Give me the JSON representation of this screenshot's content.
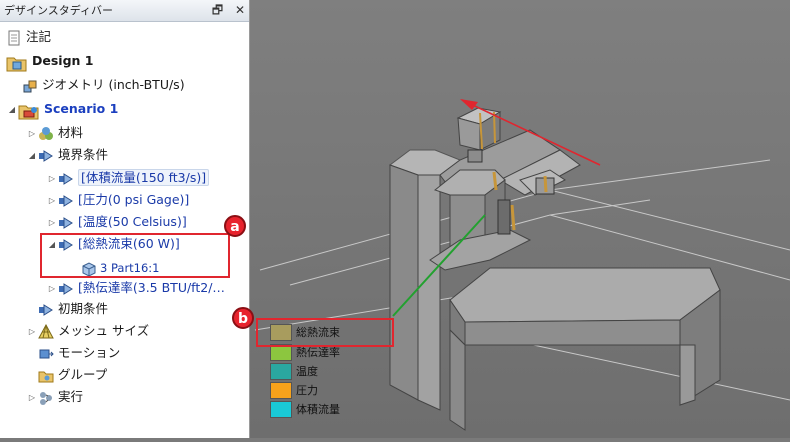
{
  "panel": {
    "title": "デザインスタディバー",
    "restore_glyph": "🗗",
    "close_glyph": "✕"
  },
  "tree": {
    "notes": "注記",
    "design": "Design 1",
    "geometry": "ジオメトリ (inch-BTU/s)",
    "scenario": "Scenario 1",
    "materials": "材料",
    "boundary_conditions": "境界条件",
    "bc_volume_flow": "[体積流量(150 ft3/s)]",
    "bc_pressure": "[圧力(0 psi Gage)]",
    "bc_temperature": "[温度(50 Celsius)]",
    "bc_total_heat": "[総熱流束(60 W)]",
    "bc_total_heat_child": "3 Part16:1",
    "bc_heat_transfer": "[熱伝達率(3.5 BTU/ft2/…",
    "initial_conditions": "初期条件",
    "mesh_size": "メッシュ サイズ",
    "motion": "モーション",
    "groups": "グループ",
    "run": "実行"
  },
  "callouts": {
    "a": "a",
    "b": "b"
  },
  "legend": [
    {
      "label": "総熱流束",
      "color": "#a89c5e"
    },
    {
      "label": "熱伝達率",
      "color": "#8cc63f"
    },
    {
      "label": "温度",
      "color": "#2aa7a0"
    },
    {
      "label": "圧力",
      "color": "#f7a21b"
    },
    {
      "label": "体積流量",
      "color": "#19c9d6"
    }
  ],
  "colors": {
    "accent": "#e0262f",
    "scenario_text": "#1b3fbf",
    "background": "#7a7a7a"
  }
}
